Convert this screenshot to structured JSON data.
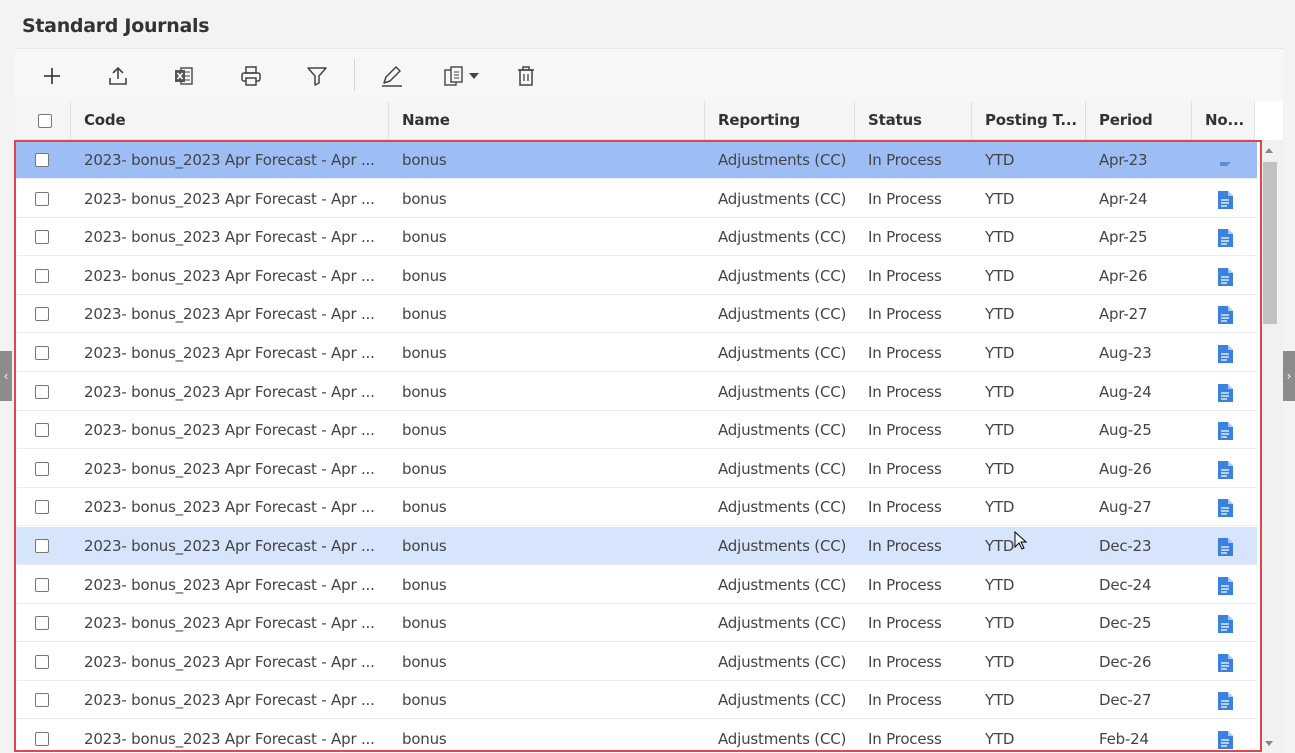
{
  "page": {
    "title": "Standard Journals"
  },
  "toolbar": {
    "buttons": [
      {
        "name": "add-button",
        "icon": "plus-icon"
      },
      {
        "name": "upload-button",
        "icon": "upload-icon"
      },
      {
        "name": "excel-export-button",
        "icon": "excel-icon"
      },
      {
        "name": "print-button",
        "icon": "printer-icon"
      },
      {
        "name": "filter-button",
        "icon": "filter-icon"
      },
      {
        "name": "edit-button",
        "icon": "pencil-icon"
      },
      {
        "name": "copy-dropdown-button",
        "icon": "copy-icon"
      },
      {
        "name": "delete-button",
        "icon": "trash-icon"
      }
    ]
  },
  "grid": {
    "columns": {
      "code": "Code",
      "name": "Name",
      "reporting": "Reporting",
      "status": "Status",
      "posting_type": "Posting T...",
      "period": "Period",
      "notes": "No..."
    },
    "rows": [
      {
        "code": "2023- bonus_2023 Apr Forecast - Apr ...",
        "name": "bonus",
        "reporting": "Adjustments (CC)",
        "status": "In Process",
        "posting_type": "YTD",
        "period": "Apr-23"
      },
      {
        "code": "2023- bonus_2023 Apr Forecast - Apr ...",
        "name": "bonus",
        "reporting": "Adjustments (CC)",
        "status": "In Process",
        "posting_type": "YTD",
        "period": "Apr-24"
      },
      {
        "code": "2023- bonus_2023 Apr Forecast - Apr ...",
        "name": "bonus",
        "reporting": "Adjustments (CC)",
        "status": "In Process",
        "posting_type": "YTD",
        "period": "Apr-25"
      },
      {
        "code": "2023- bonus_2023 Apr Forecast - Apr ...",
        "name": "bonus",
        "reporting": "Adjustments (CC)",
        "status": "In Process",
        "posting_type": "YTD",
        "period": "Apr-26"
      },
      {
        "code": "2023- bonus_2023 Apr Forecast - Apr ...",
        "name": "bonus",
        "reporting": "Adjustments (CC)",
        "status": "In Process",
        "posting_type": "YTD",
        "period": "Apr-27"
      },
      {
        "code": "2023- bonus_2023 Apr Forecast - Apr ...",
        "name": "bonus",
        "reporting": "Adjustments (CC)",
        "status": "In Process",
        "posting_type": "YTD",
        "period": "Aug-23"
      },
      {
        "code": "2023- bonus_2023 Apr Forecast - Apr ...",
        "name": "bonus",
        "reporting": "Adjustments (CC)",
        "status": "In Process",
        "posting_type": "YTD",
        "period": "Aug-24"
      },
      {
        "code": "2023- bonus_2023 Apr Forecast - Apr ...",
        "name": "bonus",
        "reporting": "Adjustments (CC)",
        "status": "In Process",
        "posting_type": "YTD",
        "period": "Aug-25"
      },
      {
        "code": "2023- bonus_2023 Apr Forecast - Apr ...",
        "name": "bonus",
        "reporting": "Adjustments (CC)",
        "status": "In Process",
        "posting_type": "YTD",
        "period": "Aug-26"
      },
      {
        "code": "2023- bonus_2023 Apr Forecast - Apr ...",
        "name": "bonus",
        "reporting": "Adjustments (CC)",
        "status": "In Process",
        "posting_type": "YTD",
        "period": "Aug-27"
      },
      {
        "code": "2023- bonus_2023 Apr Forecast - Apr ...",
        "name": "bonus",
        "reporting": "Adjustments (CC)",
        "status": "In Process",
        "posting_type": "YTD",
        "period": "Dec-23"
      },
      {
        "code": "2023- bonus_2023 Apr Forecast - Apr ...",
        "name": "bonus",
        "reporting": "Adjustments (CC)",
        "status": "In Process",
        "posting_type": "YTD",
        "period": "Dec-24"
      },
      {
        "code": "2023- bonus_2023 Apr Forecast - Apr ...",
        "name": "bonus",
        "reporting": "Adjustments (CC)",
        "status": "In Process",
        "posting_type": "YTD",
        "period": "Dec-25"
      },
      {
        "code": "2023- bonus_2023 Apr Forecast - Apr ...",
        "name": "bonus",
        "reporting": "Adjustments (CC)",
        "status": "In Process",
        "posting_type": "YTD",
        "period": "Dec-26"
      },
      {
        "code": "2023- bonus_2023 Apr Forecast - Apr ...",
        "name": "bonus",
        "reporting": "Adjustments (CC)",
        "status": "In Process",
        "posting_type": "YTD",
        "period": "Dec-27"
      },
      {
        "code": "2023- bonus_2023 Apr Forecast - Apr ...",
        "name": "bonus",
        "reporting": "Adjustments (CC)",
        "status": "In Process",
        "posting_type": "YTD",
        "period": "Feb-24"
      }
    ],
    "selected_row": 0,
    "hovered_row": 10
  },
  "colors": {
    "selected_row": "#9dbdf5",
    "hovered_row": "#d6e5fb",
    "highlight_border": "#e0464a",
    "note_icon": "#3b82e0"
  }
}
